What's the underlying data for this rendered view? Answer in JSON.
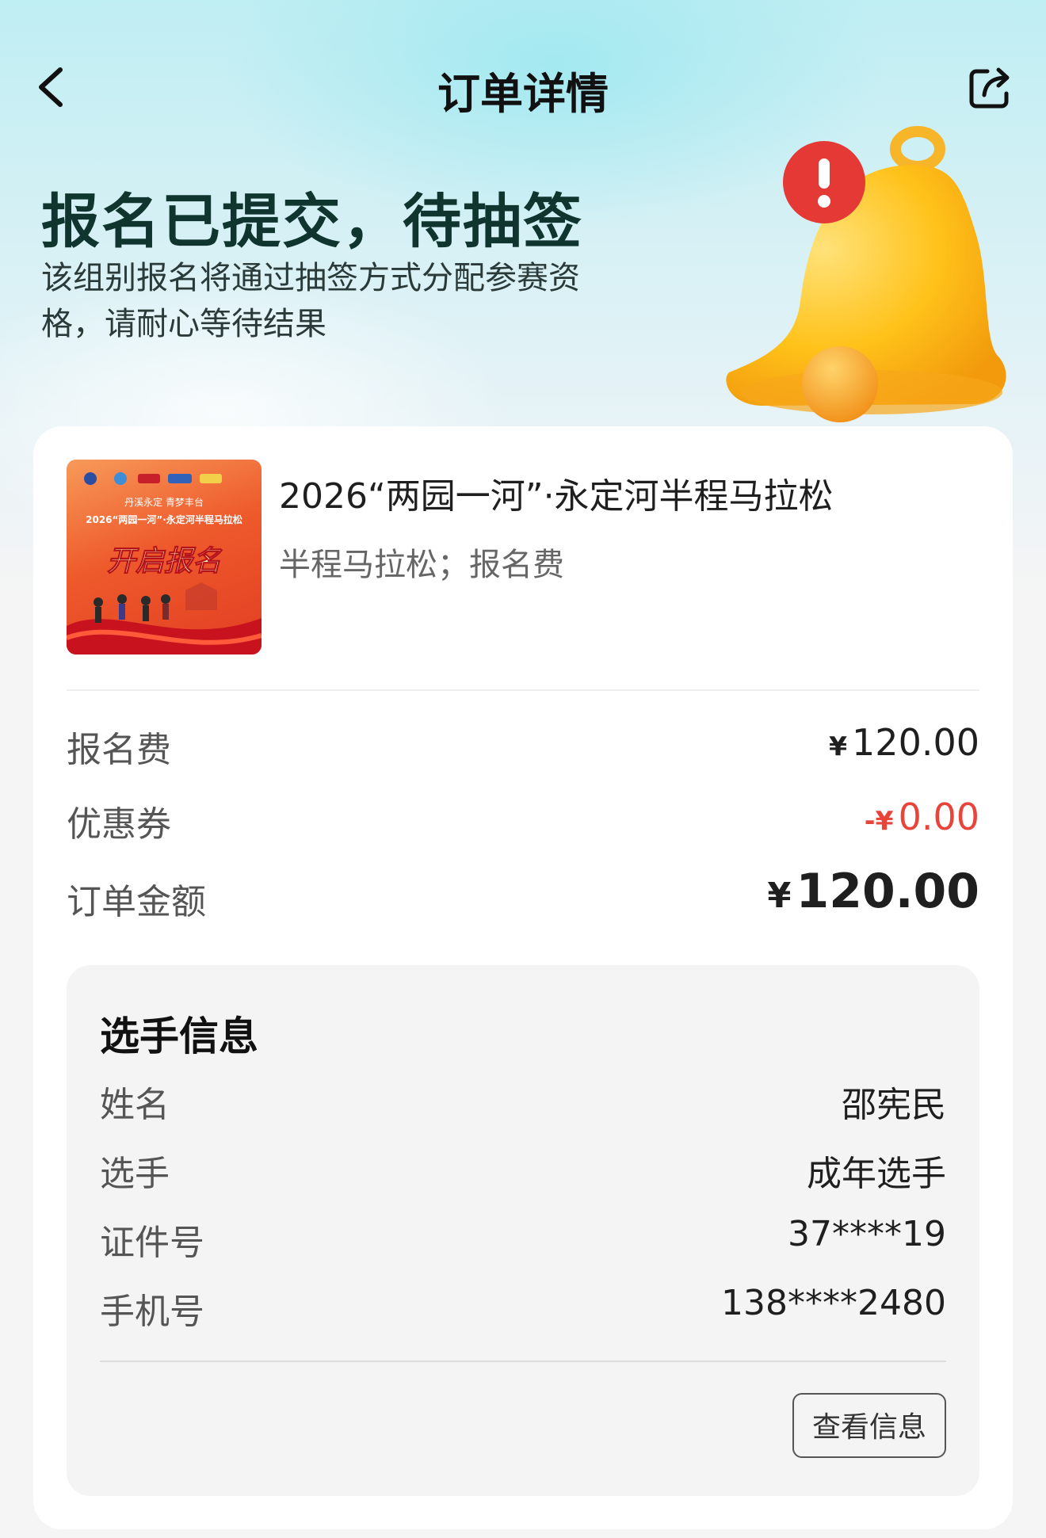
{
  "nav": {
    "title": "订单详情"
  },
  "status": {
    "title": "报名已提交，待抽签",
    "description": "该组别报名将通过抽签方式分配参赛资格，请耐心等待结果"
  },
  "event": {
    "name": "2026“两园一河”·永定河半程马拉松",
    "subtitle": "半程马拉松；报名费",
    "poster": {
      "top_line": "丹溪永定 青梦丰台",
      "title": "2026“两园一河”·永定河半程马拉松",
      "slogan": "开启报名"
    }
  },
  "fees": {
    "reg_fee_label": "报名费",
    "reg_fee_currency": "¥",
    "reg_fee_value": "120.00",
    "coupon_label": "优惠券",
    "coupon_prefix": "-¥",
    "coupon_value": "0.00",
    "total_label": "订单金额",
    "total_currency": "¥",
    "total_value": "120.00"
  },
  "player": {
    "section_title": "选手信息",
    "rows": [
      {
        "label": "姓名",
        "value": "邵宪民"
      },
      {
        "label": "选手",
        "value": "成年选手"
      },
      {
        "label": "证件号",
        "value": "37****19"
      },
      {
        "label": "手机号",
        "value": "138****2480"
      }
    ],
    "view_button": "查看信息"
  },
  "colors": {
    "accent_red": "#e8443a",
    "title_green": "#10352f",
    "bell_yellow": "#ffc21a"
  }
}
